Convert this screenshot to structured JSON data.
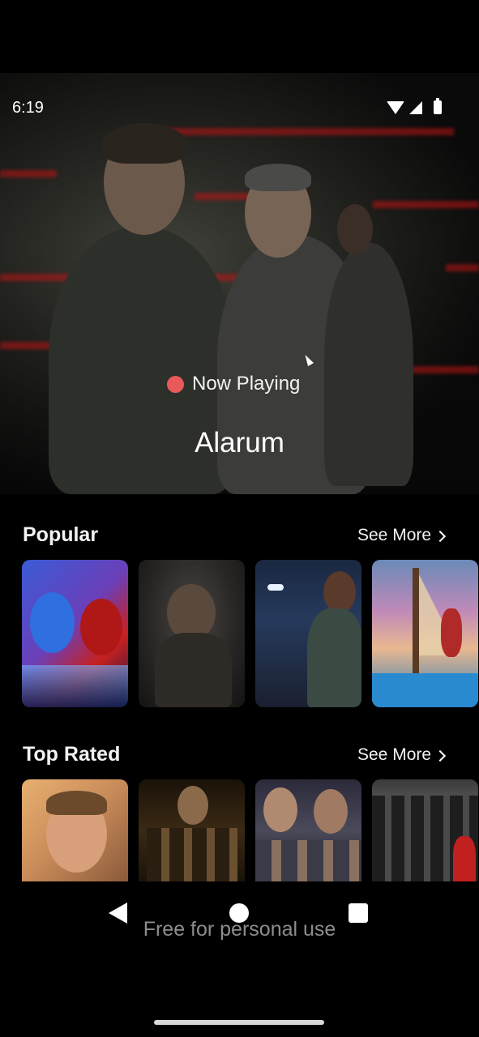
{
  "status_bar": {
    "time": "6:19"
  },
  "hero": {
    "badge_label": "Now Playing",
    "title": "Alarum"
  },
  "sections": [
    {
      "title": "Popular",
      "see_more_label": "See More"
    },
    {
      "title": "Top Rated",
      "see_more_label": "See More"
    }
  ],
  "watermark": "Free for personal use",
  "colors": {
    "accent_dot": "#e85a5a",
    "background": "#000000"
  }
}
